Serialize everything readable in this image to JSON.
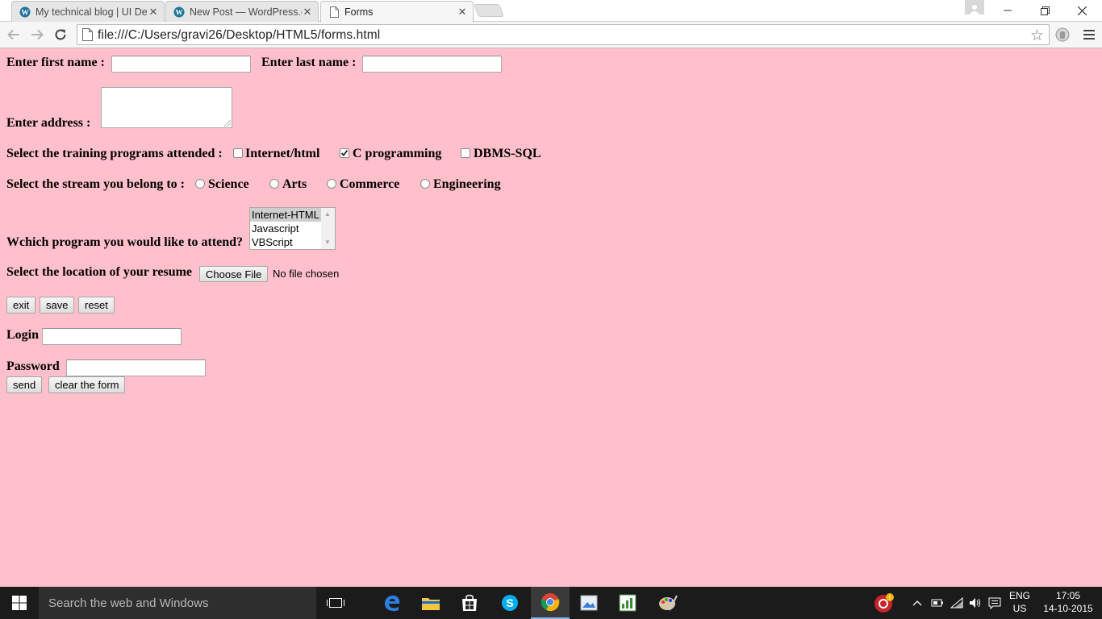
{
  "browser": {
    "tabs": [
      {
        "title": "My technical blog | UI Dev",
        "icon": "wordpress-icon",
        "active": false
      },
      {
        "title": "New Post — WordPress.co",
        "icon": "wordpress-icon",
        "active": false
      },
      {
        "title": "Forms",
        "icon": "page-icon",
        "active": true
      }
    ],
    "url": "file:///C:/Users/gravi26/Desktop/HTML5/forms.html"
  },
  "form": {
    "first_name_label": "Enter first name :",
    "first_name_value": "",
    "last_name_label": "Enter last name :",
    "last_name_value": "",
    "address_label": "Enter address :",
    "address_value": "",
    "training_label": "Select the training programs attended :",
    "training_options": [
      {
        "label": "Internet/html",
        "checked": false
      },
      {
        "label": "C programming",
        "checked": true
      },
      {
        "label": "DBMS-SQL",
        "checked": false
      }
    ],
    "stream_label": "Select the stream you belong to :",
    "stream_options": [
      {
        "label": "Science",
        "selected": false
      },
      {
        "label": "Arts",
        "selected": false
      },
      {
        "label": "Commerce",
        "selected": false
      },
      {
        "label": "Engineering",
        "selected": false
      }
    ],
    "program_label": "Wchich program you would like to attend?",
    "program_options": [
      "Internet-HTML",
      "Javascript",
      "VBScript"
    ],
    "program_selected": "Internet-HTML",
    "resume_label": "Select the location of your resume",
    "choose_file_label": "Choose File",
    "no_file_text": "No file chosen",
    "buttons": {
      "exit": "exit",
      "save": "save",
      "reset": "reset"
    },
    "login_label": "Login",
    "login_value": "",
    "password_label": "Password",
    "password_value": "",
    "send_label": "send",
    "clear_label": "clear the form"
  },
  "taskbar": {
    "search_placeholder": "Search the web and Windows",
    "language_line1": "ENG",
    "language_line2": "US",
    "time": "17:05",
    "date": "14-10-2015"
  }
}
